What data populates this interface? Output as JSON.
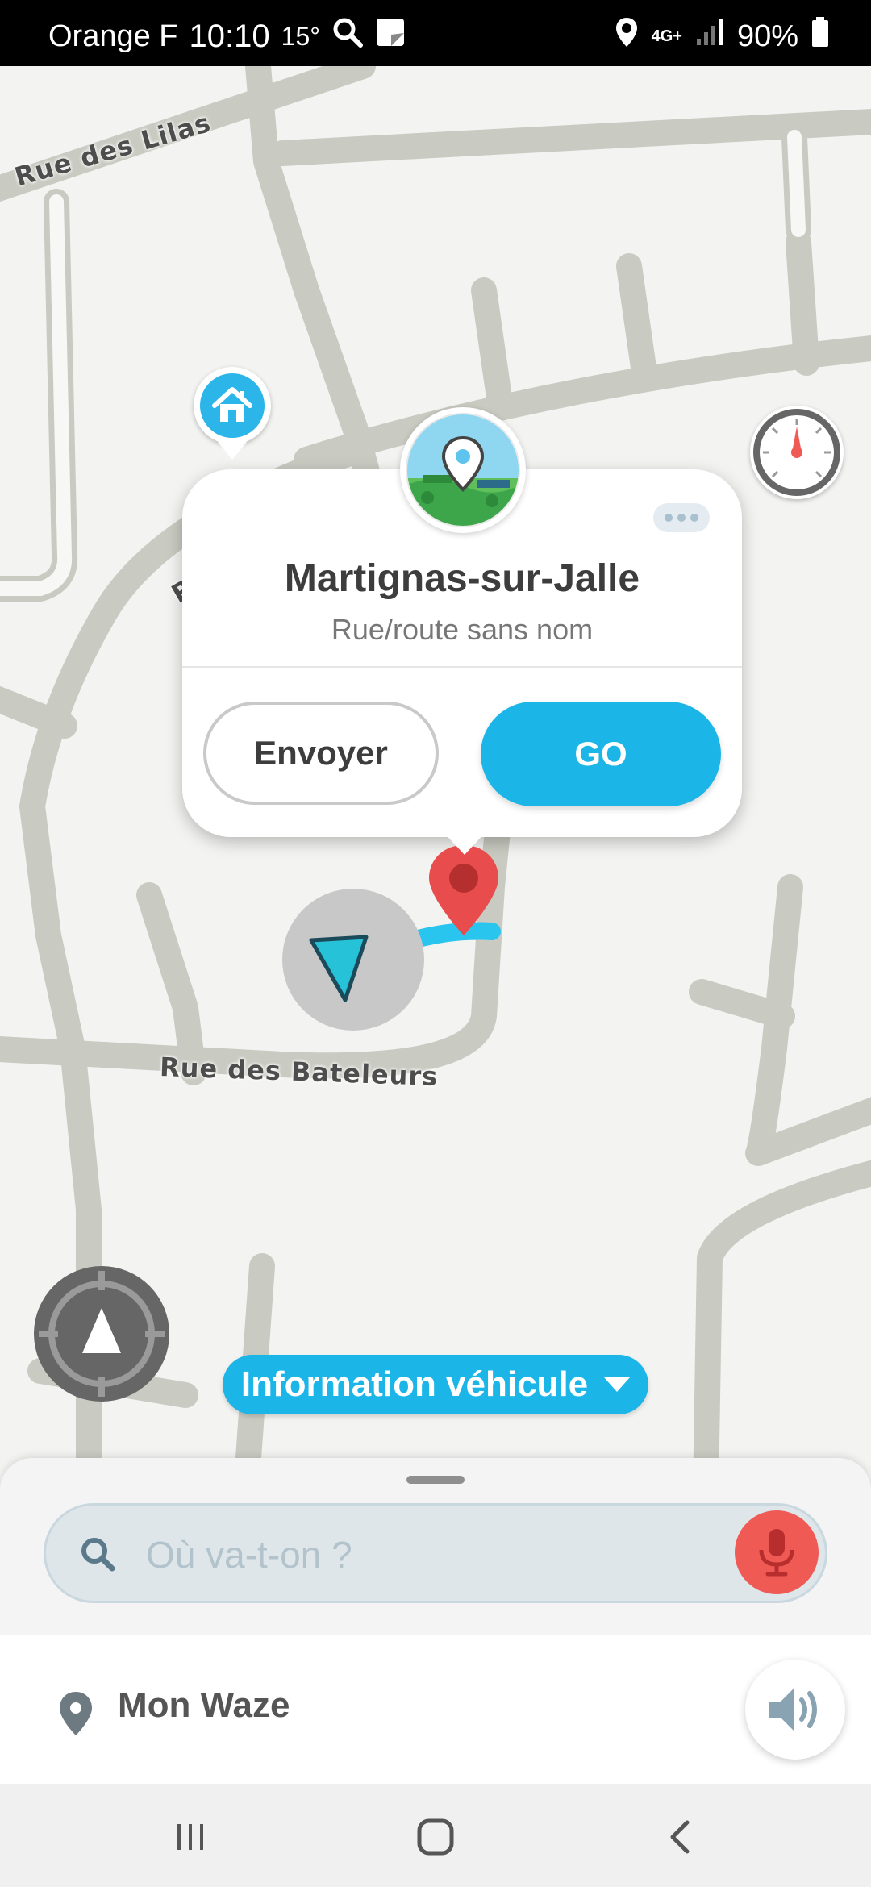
{
  "status_bar": {
    "carrier": "Orange F",
    "time": "10:10",
    "temperature": "15°",
    "network": "4G+",
    "battery": "90%"
  },
  "map": {
    "street_labels": [
      "Rue des Lilas",
      "Rue des Bateleurs"
    ],
    "partial_label": "R"
  },
  "popup": {
    "title": "Martignas-sur-Jalle",
    "subtitle": "Rue/route sans nom",
    "send_label": "Envoyer",
    "go_label": "GO"
  },
  "vehicle_info": {
    "label": "Information véhicule"
  },
  "search": {
    "placeholder": "Où va-t-on ?"
  },
  "bottom": {
    "label": "Mon Waze"
  },
  "icons": {
    "search": "search-icon",
    "mic": "microphone-icon",
    "home": "home-icon",
    "speedometer": "speedometer-icon",
    "recenter": "recenter-icon",
    "sound": "speaker-icon",
    "location": "location-pin-icon"
  },
  "colors": {
    "accent": "#1cb5e8",
    "mic": "#ef5a55",
    "destination_pin": "#e84c4c"
  }
}
